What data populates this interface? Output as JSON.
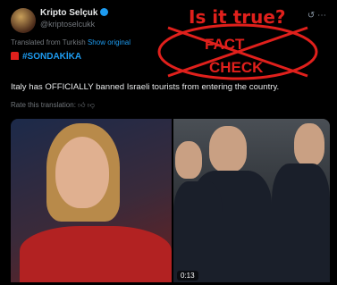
{
  "post": {
    "display_name": "Kripto Selçuk",
    "handle": "@kriptoselcukk",
    "translated_note": "Translated from Turkish",
    "show_original": "Show original",
    "hashtag": "#SONDAKİKA",
    "text": "Italy has OFFICIALLY banned Israeli tourists from entering the country.",
    "rate_translation": "Rate this translation:",
    "video_time": "0:13"
  },
  "overlay": {
    "question": "Is it true?",
    "fact_line1": "FACT",
    "fact_line2": "CHECK",
    "color": "#e0201c"
  },
  "icons": {
    "verified": "verified-badge-icon",
    "grok": "grok-icon",
    "more": "more-icon",
    "siren": "siren-icon",
    "thumbs_up": "thumbs-up-icon",
    "thumbs_down": "thumbs-down-icon"
  }
}
